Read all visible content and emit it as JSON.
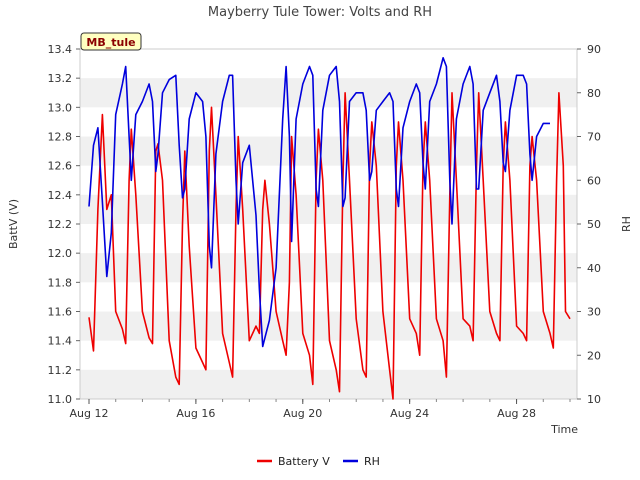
{
  "chart_data": {
    "type": "line",
    "title": "Mayberry Tule Tower: Volts and RH",
    "station_label": "MB_tule",
    "xlabel": "Time",
    "ylabel_left": "BattV (V)",
    "ylabel_right": "RH",
    "x_range": [
      "2024-08-12",
      "2024-08-30"
    ],
    "x_ticks": [
      "Aug 12",
      "Aug 16",
      "Aug 20",
      "Aug 24",
      "Aug 28"
    ],
    "ylim_left": [
      11.0,
      13.4
    ],
    "yticks_left": [
      "11.0",
      "11.2",
      "11.4",
      "11.6",
      "11.8",
      "12.0",
      "12.2",
      "12.4",
      "12.6",
      "12.8",
      "13.0",
      "13.2",
      "13.4"
    ],
    "ylim_right": [
      10,
      90
    ],
    "yticks_right": [
      "10",
      "20",
      "30",
      "40",
      "50",
      "60",
      "70",
      "80",
      "90"
    ],
    "grid": "horizontal bands",
    "legend_position": "bottom-center",
    "colors": {
      "battery": "#ee0000",
      "rh": "#0000dd",
      "band": "#f0f0f0",
      "label_bg": "#ffffc0"
    },
    "series": [
      {
        "name": "Battery V",
        "axis": "left",
        "points": [
          [
            "2024-08-12 00:00",
            11.56
          ],
          [
            "2024-08-12 04:00",
            11.33
          ],
          [
            "2024-08-12 08:00",
            12.3
          ],
          [
            "2024-08-12 12:00",
            12.95
          ],
          [
            "2024-08-12 16:00",
            12.3
          ],
          [
            "2024-08-12 20:00",
            12.4
          ],
          [
            "2024-08-13 00:00",
            11.6
          ],
          [
            "2024-08-13 06:00",
            11.48
          ],
          [
            "2024-08-13 09:00",
            11.38
          ],
          [
            "2024-08-13 12:00",
            12.5
          ],
          [
            "2024-08-13 14:00",
            12.85
          ],
          [
            "2024-08-13 18:00",
            12.4
          ],
          [
            "2024-08-14 00:00",
            11.6
          ],
          [
            "2024-08-14 06:00",
            11.42
          ],
          [
            "2024-08-14 09:00",
            11.38
          ],
          [
            "2024-08-14 12:00",
            12.7
          ],
          [
            "2024-08-14 14:00",
            12.75
          ],
          [
            "2024-08-14 18:00",
            12.5
          ],
          [
            "2024-08-15 00:00",
            11.4
          ],
          [
            "2024-08-15 06:00",
            11.15
          ],
          [
            "2024-08-15 09:00",
            11.1
          ],
          [
            "2024-08-15 12:00",
            12.2
          ],
          [
            "2024-08-15 14:00",
            12.7
          ],
          [
            "2024-08-15 18:00",
            12.05
          ],
          [
            "2024-08-16 00:00",
            11.35
          ],
          [
            "2024-08-16 06:00",
            11.25
          ],
          [
            "2024-08-16 09:00",
            11.2
          ],
          [
            "2024-08-16 12:00",
            12.7
          ],
          [
            "2024-08-16 14:00",
            13.0
          ],
          [
            "2024-08-16 18:00",
            12.4
          ],
          [
            "2024-08-17 00:00",
            11.45
          ],
          [
            "2024-08-17 06:00",
            11.25
          ],
          [
            "2024-08-17 09:00",
            11.15
          ],
          [
            "2024-08-17 12:00",
            12.3
          ],
          [
            "2024-08-17 14:00",
            12.8
          ],
          [
            "2024-08-17 18:00",
            12.3
          ],
          [
            "2024-08-18 00:00",
            11.4
          ],
          [
            "2024-08-18 06:00",
            11.5
          ],
          [
            "2024-08-18 09:00",
            11.45
          ],
          [
            "2024-08-18 12:00",
            12.3
          ],
          [
            "2024-08-18 14:00",
            12.5
          ],
          [
            "2024-08-18 18:00",
            12.2
          ],
          [
            "2024-08-19 00:00",
            11.6
          ],
          [
            "2024-08-19 06:00",
            11.4
          ],
          [
            "2024-08-19 09:00",
            11.3
          ],
          [
            "2024-08-19 12:00",
            11.8
          ],
          [
            "2024-08-19 14:00",
            12.8
          ],
          [
            "2024-08-19 18:00",
            12.4
          ],
          [
            "2024-08-20 00:00",
            11.45
          ],
          [
            "2024-08-20 06:00",
            11.3
          ],
          [
            "2024-08-20 09:00",
            11.1
          ],
          [
            "2024-08-20 12:00",
            12.5
          ],
          [
            "2024-08-20 14:00",
            12.85
          ],
          [
            "2024-08-20 18:00",
            12.5
          ],
          [
            "2024-08-21 00:00",
            11.4
          ],
          [
            "2024-08-21 06:00",
            11.2
          ],
          [
            "2024-08-21 09:00",
            11.05
          ],
          [
            "2024-08-21 12:00",
            12.5
          ],
          [
            "2024-08-21 14:00",
            13.1
          ],
          [
            "2024-08-21 18:00",
            12.5
          ],
          [
            "2024-08-22 00:00",
            11.55
          ],
          [
            "2024-08-22 06:00",
            11.2
          ],
          [
            "2024-08-22 09:00",
            11.15
          ],
          [
            "2024-08-22 12:00",
            12.6
          ],
          [
            "2024-08-22 14:00",
            12.9
          ],
          [
            "2024-08-22 18:00",
            12.6
          ],
          [
            "2024-08-23 00:00",
            11.6
          ],
          [
            "2024-08-23 06:00",
            11.2
          ],
          [
            "2024-08-23 09:00",
            11.0
          ],
          [
            "2024-08-23 12:00",
            12.6
          ],
          [
            "2024-08-23 14:00",
            12.9
          ],
          [
            "2024-08-23 18:00",
            12.5
          ],
          [
            "2024-08-24 00:00",
            11.55
          ],
          [
            "2024-08-24 06:00",
            11.45
          ],
          [
            "2024-08-24 09:00",
            11.3
          ],
          [
            "2024-08-24 12:00",
            12.6
          ],
          [
            "2024-08-24 14:00",
            12.9
          ],
          [
            "2024-08-24 18:00",
            12.5
          ],
          [
            "2024-08-25 00:00",
            11.55
          ],
          [
            "2024-08-25 06:00",
            11.4
          ],
          [
            "2024-08-25 09:00",
            11.15
          ],
          [
            "2024-08-25 12:00",
            12.4
          ],
          [
            "2024-08-25 14:00",
            13.1
          ],
          [
            "2024-08-25 18:00",
            12.5
          ],
          [
            "2024-08-26 00:00",
            11.55
          ],
          [
            "2024-08-26 06:00",
            11.5
          ],
          [
            "2024-08-26 09:00",
            11.4
          ],
          [
            "2024-08-26 12:00",
            12.6
          ],
          [
            "2024-08-26 14:00",
            13.1
          ],
          [
            "2024-08-26 18:00",
            12.5
          ],
          [
            "2024-08-27 00:00",
            11.6
          ],
          [
            "2024-08-27 06:00",
            11.45
          ],
          [
            "2024-08-27 09:00",
            11.4
          ],
          [
            "2024-08-27 12:00",
            12.6
          ],
          [
            "2024-08-27 14:00",
            12.9
          ],
          [
            "2024-08-27 18:00",
            12.5
          ],
          [
            "2024-08-28 00:00",
            11.5
          ],
          [
            "2024-08-28 06:00",
            11.45
          ],
          [
            "2024-08-28 09:00",
            11.4
          ],
          [
            "2024-08-28 12:00",
            12.6
          ],
          [
            "2024-08-28 14:00",
            12.8
          ],
          [
            "2024-08-28 18:00",
            12.5
          ],
          [
            "2024-08-29 00:00",
            11.6
          ],
          [
            "2024-08-29 06:00",
            11.45
          ],
          [
            "2024-08-29 09:00",
            11.35
          ],
          [
            "2024-08-29 12:00",
            12.5
          ],
          [
            "2024-08-29 14:00",
            13.1
          ],
          [
            "2024-08-29 18:00",
            12.6
          ],
          [
            "2024-08-29 20:00",
            11.6
          ],
          [
            "2024-08-30 00:00",
            11.55
          ]
        ]
      },
      {
        "name": "RH",
        "axis": "right",
        "points": [
          [
            "2024-08-12 00:00",
            54
          ],
          [
            "2024-08-12 04:00",
            68
          ],
          [
            "2024-08-12 08:00",
            72
          ],
          [
            "2024-08-12 12:00",
            55
          ],
          [
            "2024-08-12 16:00",
            38
          ],
          [
            "2024-08-12 20:00",
            48
          ],
          [
            "2024-08-13 00:00",
            75
          ],
          [
            "2024-08-13 06:00",
            82
          ],
          [
            "2024-08-13 09:00",
            86
          ],
          [
            "2024-08-13 12:00",
            70
          ],
          [
            "2024-08-13 14:00",
            60
          ],
          [
            "2024-08-13 18:00",
            75
          ],
          [
            "2024-08-14 00:00",
            78
          ],
          [
            "2024-08-14 06:00",
            82
          ],
          [
            "2024-08-14 09:00",
            78
          ],
          [
            "2024-08-14 12:00",
            62
          ],
          [
            "2024-08-14 14:00",
            66
          ],
          [
            "2024-08-14 18:00",
            80
          ],
          [
            "2024-08-15 00:00",
            83
          ],
          [
            "2024-08-15 06:00",
            84
          ],
          [
            "2024-08-15 09:00",
            68
          ],
          [
            "2024-08-15 12:00",
            56
          ],
          [
            "2024-08-15 14:00",
            58
          ],
          [
            "2024-08-15 18:00",
            74
          ],
          [
            "2024-08-16 00:00",
            80
          ],
          [
            "2024-08-16 06:00",
            78
          ],
          [
            "2024-08-16 09:00",
            70
          ],
          [
            "2024-08-16 12:00",
            45
          ],
          [
            "2024-08-16 14:00",
            40
          ],
          [
            "2024-08-16 18:00",
            66
          ],
          [
            "2024-08-17 00:00",
            78
          ],
          [
            "2024-08-17 06:00",
            84
          ],
          [
            "2024-08-17 09:00",
            84
          ],
          [
            "2024-08-17 12:00",
            60
          ],
          [
            "2024-08-17 14:00",
            50
          ],
          [
            "2024-08-17 18:00",
            64
          ],
          [
            "2024-08-18 00:00",
            68
          ],
          [
            "2024-08-18 06:00",
            52
          ],
          [
            "2024-08-18 09:00",
            35
          ],
          [
            "2024-08-18 12:00",
            22
          ],
          [
            "2024-08-18 14:00",
            24
          ],
          [
            "2024-08-18 18:00",
            28
          ],
          [
            "2024-08-19 00:00",
            40
          ],
          [
            "2024-08-19 06:00",
            74
          ],
          [
            "2024-08-19 09:00",
            86
          ],
          [
            "2024-08-19 12:00",
            70
          ],
          [
            "2024-08-19 14:00",
            46
          ],
          [
            "2024-08-19 18:00",
            74
          ],
          [
            "2024-08-20 00:00",
            82
          ],
          [
            "2024-08-20 06:00",
            86
          ],
          [
            "2024-08-20 09:00",
            84
          ],
          [
            "2024-08-20 12:00",
            58
          ],
          [
            "2024-08-20 14:00",
            54
          ],
          [
            "2024-08-20 18:00",
            76
          ],
          [
            "2024-08-21 00:00",
            84
          ],
          [
            "2024-08-21 06:00",
            86
          ],
          [
            "2024-08-21 09:00",
            78
          ],
          [
            "2024-08-21 12:00",
            54
          ],
          [
            "2024-08-21 14:00",
            56
          ],
          [
            "2024-08-21 18:00",
            78
          ],
          [
            "2024-08-22 00:00",
            80
          ],
          [
            "2024-08-22 06:00",
            80
          ],
          [
            "2024-08-22 09:00",
            76
          ],
          [
            "2024-08-22 12:00",
            60
          ],
          [
            "2024-08-22 14:00",
            62
          ],
          [
            "2024-08-22 18:00",
            76
          ],
          [
            "2024-08-23 00:00",
            78
          ],
          [
            "2024-08-23 06:00",
            80
          ],
          [
            "2024-08-23 09:00",
            78
          ],
          [
            "2024-08-23 12:00",
            58
          ],
          [
            "2024-08-23 14:00",
            54
          ],
          [
            "2024-08-23 18:00",
            72
          ],
          [
            "2024-08-24 00:00",
            78
          ],
          [
            "2024-08-24 06:00",
            82
          ],
          [
            "2024-08-24 09:00",
            80
          ],
          [
            "2024-08-24 12:00",
            64
          ],
          [
            "2024-08-24 14:00",
            58
          ],
          [
            "2024-08-24 18:00",
            78
          ],
          [
            "2024-08-25 00:00",
            82
          ],
          [
            "2024-08-25 06:00",
            88
          ],
          [
            "2024-08-25 09:00",
            86
          ],
          [
            "2024-08-25 12:00",
            60
          ],
          [
            "2024-08-25 14:00",
            50
          ],
          [
            "2024-08-25 18:00",
            74
          ],
          [
            "2024-08-26 00:00",
            82
          ],
          [
            "2024-08-26 06:00",
            86
          ],
          [
            "2024-08-26 09:00",
            82
          ],
          [
            "2024-08-26 12:00",
            58
          ],
          [
            "2024-08-26 14:00",
            58
          ],
          [
            "2024-08-26 18:00",
            76
          ],
          [
            "2024-08-27 00:00",
            80
          ],
          [
            "2024-08-27 06:00",
            84
          ],
          [
            "2024-08-27 09:00",
            78
          ],
          [
            "2024-08-27 12:00",
            64
          ],
          [
            "2024-08-27 14:00",
            62
          ],
          [
            "2024-08-27 18:00",
            76
          ],
          [
            "2024-08-28 00:00",
            84
          ],
          [
            "2024-08-28 06:00",
            84
          ],
          [
            "2024-08-28 09:00",
            82
          ],
          [
            "2024-08-28 12:00",
            66
          ],
          [
            "2024-08-28 14:00",
            60
          ],
          [
            "2024-08-28 18:00",
            70
          ],
          [
            "2024-08-29 00:00",
            73
          ],
          [
            "2024-08-29 06:00",
            73
          ]
        ]
      }
    ]
  }
}
